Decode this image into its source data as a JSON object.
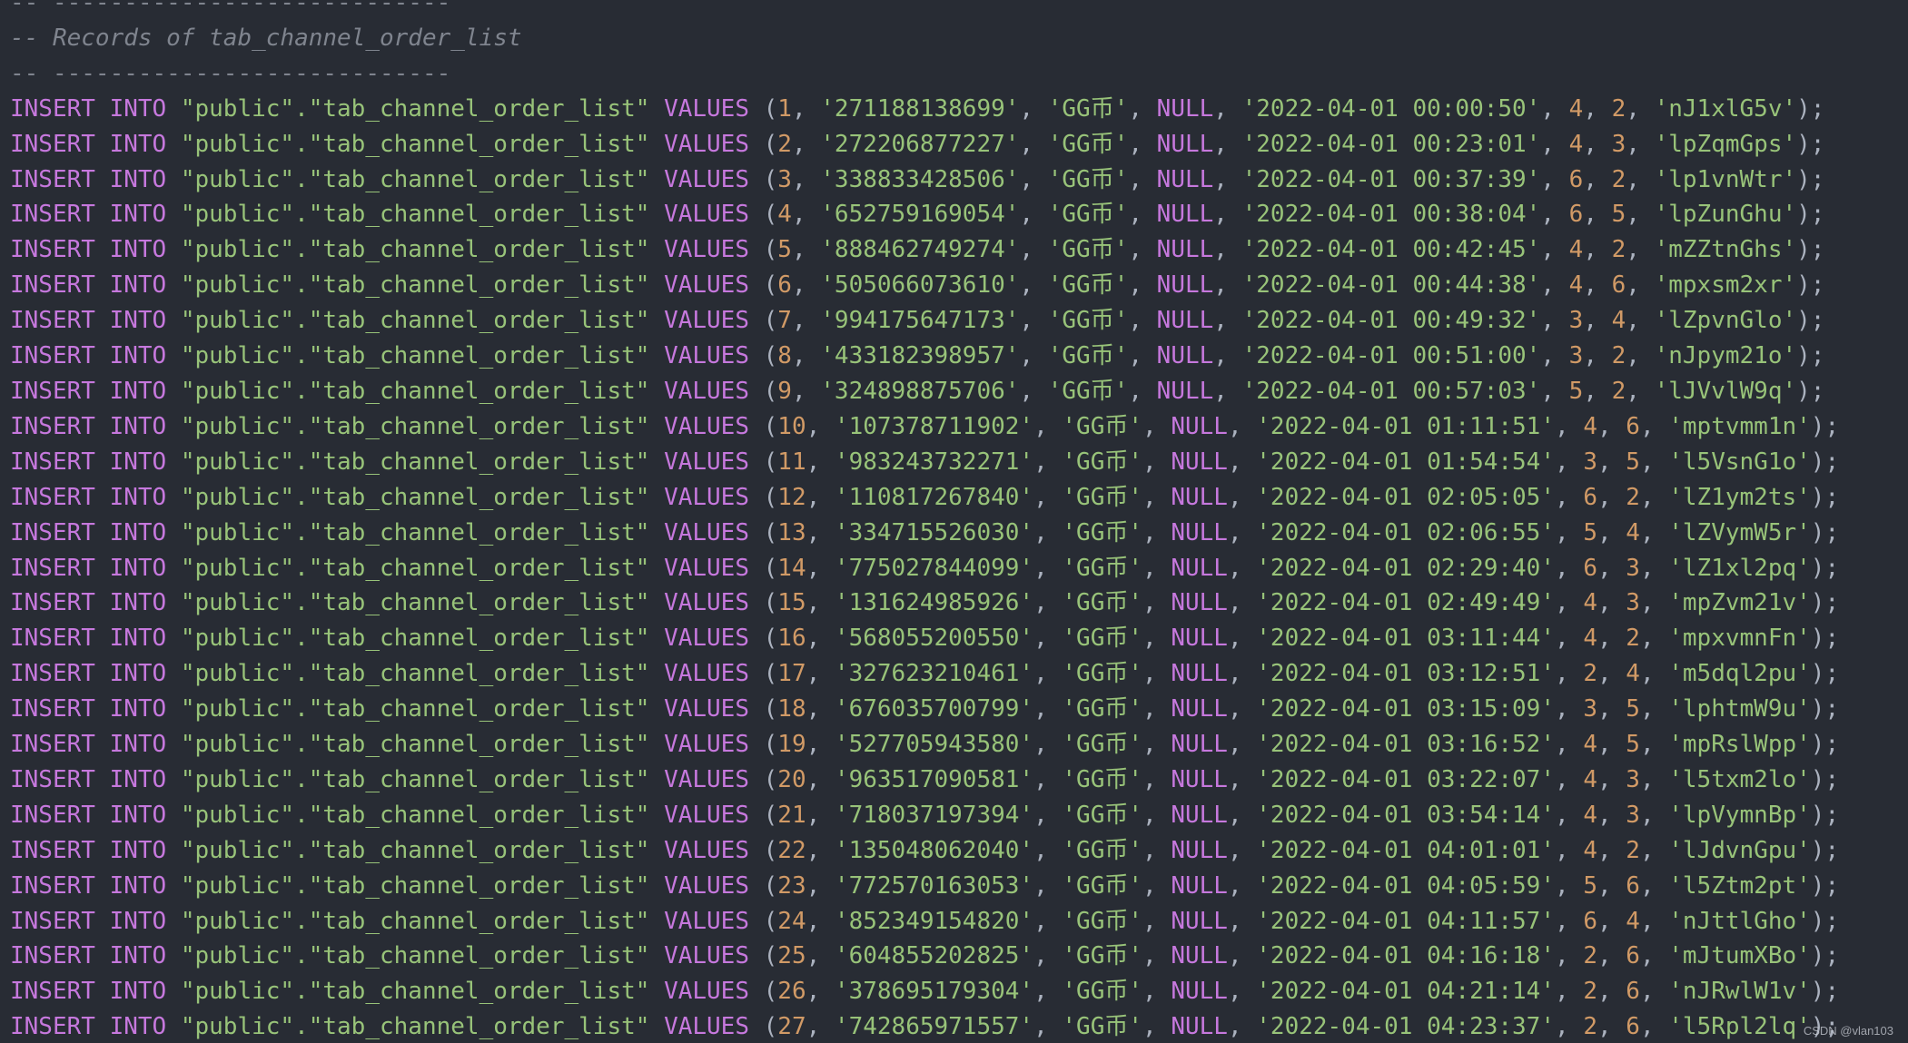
{
  "editor": {
    "comments": {
      "rule": "-- ----------------------------",
      "records_title": "-- Records of tab_channel_order_list"
    },
    "sql": {
      "insert_into": "INSERT INTO",
      "table_ref": "\"public\".\"tab_channel_order_list\"",
      "values_kw": "VALUES",
      "null_kw": "NULL"
    },
    "rows": [
      {
        "id": "1",
        "order_no": "'271188138699'",
        "currency": "'GG币'",
        "time": "'2022-04-01 00:00:50'",
        "a": "4",
        "b": "2",
        "code": "'nJ1xlG5v'"
      },
      {
        "id": "2",
        "order_no": "'272206877227'",
        "currency": "'GG币'",
        "time": "'2022-04-01 00:23:01'",
        "a": "4",
        "b": "3",
        "code": "'lpZqmGps'"
      },
      {
        "id": "3",
        "order_no": "'338833428506'",
        "currency": "'GG币'",
        "time": "'2022-04-01 00:37:39'",
        "a": "6",
        "b": "2",
        "code": "'lp1vnWtr'"
      },
      {
        "id": "4",
        "order_no": "'652759169054'",
        "currency": "'GG币'",
        "time": "'2022-04-01 00:38:04'",
        "a": "6",
        "b": "5",
        "code": "'lpZunGhu'"
      },
      {
        "id": "5",
        "order_no": "'888462749274'",
        "currency": "'GG币'",
        "time": "'2022-04-01 00:42:45'",
        "a": "4",
        "b": "2",
        "code": "'mZZtnGhs'"
      },
      {
        "id": "6",
        "order_no": "'505066073610'",
        "currency": "'GG币'",
        "time": "'2022-04-01 00:44:38'",
        "a": "4",
        "b": "6",
        "code": "'mpxsm2xr'"
      },
      {
        "id": "7",
        "order_no": "'994175647173'",
        "currency": "'GG币'",
        "time": "'2022-04-01 00:49:32'",
        "a": "3",
        "b": "4",
        "code": "'lZpvnGlo'"
      },
      {
        "id": "8",
        "order_no": "'433182398957'",
        "currency": "'GG币'",
        "time": "'2022-04-01 00:51:00'",
        "a": "3",
        "b": "2",
        "code": "'nJpym21o'"
      },
      {
        "id": "9",
        "order_no": "'324898875706'",
        "currency": "'GG币'",
        "time": "'2022-04-01 00:57:03'",
        "a": "5",
        "b": "2",
        "code": "'lJVvlW9q'"
      },
      {
        "id": "10",
        "order_no": "'107378711902'",
        "currency": "'GG币'",
        "time": "'2022-04-01 01:11:51'",
        "a": "4",
        "b": "6",
        "code": "'mptvmm1n'"
      },
      {
        "id": "11",
        "order_no": "'983243732271'",
        "currency": "'GG币'",
        "time": "'2022-04-01 01:54:54'",
        "a": "3",
        "b": "5",
        "code": "'l5VsnG1o'"
      },
      {
        "id": "12",
        "order_no": "'110817267840'",
        "currency": "'GG币'",
        "time": "'2022-04-01 02:05:05'",
        "a": "6",
        "b": "2",
        "code": "'lZ1ym2ts'"
      },
      {
        "id": "13",
        "order_no": "'334715526030'",
        "currency": "'GG币'",
        "time": "'2022-04-01 02:06:55'",
        "a": "5",
        "b": "4",
        "code": "'lZVymW5r'"
      },
      {
        "id": "14",
        "order_no": "'775027844099'",
        "currency": "'GG币'",
        "time": "'2022-04-01 02:29:40'",
        "a": "6",
        "b": "3",
        "code": "'lZ1xl2pq'"
      },
      {
        "id": "15",
        "order_no": "'131624985926'",
        "currency": "'GG币'",
        "time": "'2022-04-01 02:49:49'",
        "a": "4",
        "b": "3",
        "code": "'mpZvm21v'"
      },
      {
        "id": "16",
        "order_no": "'568055200550'",
        "currency": "'GG币'",
        "time": "'2022-04-01 03:11:44'",
        "a": "4",
        "b": "2",
        "code": "'mpxvmnFn'"
      },
      {
        "id": "17",
        "order_no": "'327623210461'",
        "currency": "'GG币'",
        "time": "'2022-04-01 03:12:51'",
        "a": "2",
        "b": "4",
        "code": "'m5dql2pu'"
      },
      {
        "id": "18",
        "order_no": "'676035700799'",
        "currency": "'GG币'",
        "time": "'2022-04-01 03:15:09'",
        "a": "3",
        "b": "5",
        "code": "'lphtmW9u'"
      },
      {
        "id": "19",
        "order_no": "'527705943580'",
        "currency": "'GG币'",
        "time": "'2022-04-01 03:16:52'",
        "a": "4",
        "b": "5",
        "code": "'mpRslWpp'"
      },
      {
        "id": "20",
        "order_no": "'963517090581'",
        "currency": "'GG币'",
        "time": "'2022-04-01 03:22:07'",
        "a": "4",
        "b": "3",
        "code": "'l5txm2lo'"
      },
      {
        "id": "21",
        "order_no": "'718037197394'",
        "currency": "'GG币'",
        "time": "'2022-04-01 03:54:14'",
        "a": "4",
        "b": "3",
        "code": "'lpVymnBp'"
      },
      {
        "id": "22",
        "order_no": "'135048062040'",
        "currency": "'GG币'",
        "time": "'2022-04-01 04:01:01'",
        "a": "4",
        "b": "2",
        "code": "'lJdvnGpu'"
      },
      {
        "id": "23",
        "order_no": "'772570163053'",
        "currency": "'GG币'",
        "time": "'2022-04-01 04:05:59'",
        "a": "5",
        "b": "6",
        "code": "'l5Ztm2pt'"
      },
      {
        "id": "24",
        "order_no": "'852349154820'",
        "currency": "'GG币'",
        "time": "'2022-04-01 04:11:57'",
        "a": "6",
        "b": "4",
        "code": "'nJttlGho'"
      },
      {
        "id": "25",
        "order_no": "'604855202825'",
        "currency": "'GG币'",
        "time": "'2022-04-01 04:16:18'",
        "a": "2",
        "b": "6",
        "code": "'mJtumXBo'"
      },
      {
        "id": "26",
        "order_no": "'378695179304'",
        "currency": "'GG币'",
        "time": "'2022-04-01 04:21:14'",
        "a": "2",
        "b": "6",
        "code": "'nJRwlW1v'"
      },
      {
        "id": "27",
        "order_no": "'742865971557'",
        "currency": "'GG币'",
        "time": "'2022-04-01 04:23:37'",
        "a": "2",
        "b": "6",
        "code": "'l5Rpl2lq'"
      }
    ]
  },
  "watermark": "CSDN @vlan103",
  "colors": {
    "background": "#282c34",
    "keyword": "#c678dd",
    "string": "#98c379",
    "number": "#d19a66",
    "comment": "#7f848e",
    "punctuation": "#abb2bf"
  }
}
